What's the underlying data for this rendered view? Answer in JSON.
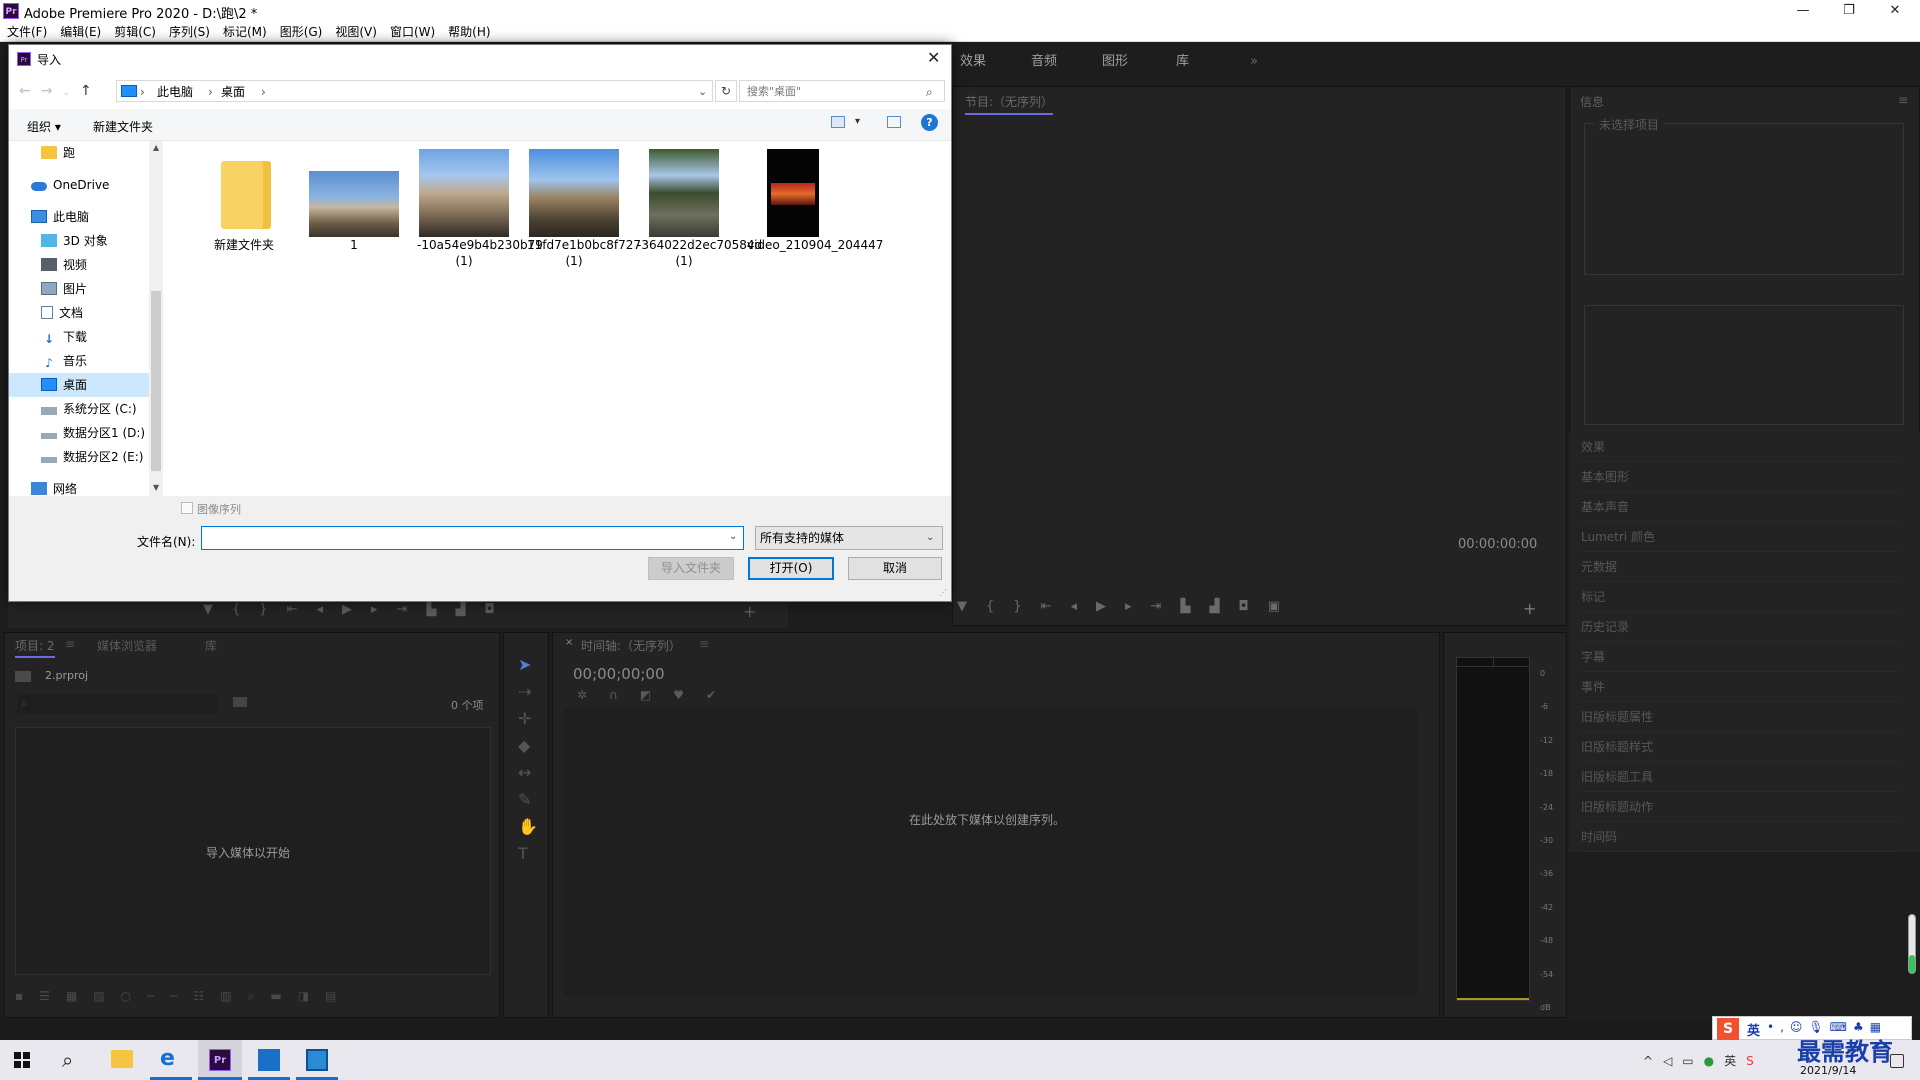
{
  "app": {
    "title": "Adobe Premiere Pro 2020 - D:\\跑\\2 *",
    "logo_text": "Pr",
    "window_buttons": [
      "—",
      "❐",
      "✕"
    ]
  },
  "menu": [
    "文件(F)",
    "编辑(E)",
    "剪辑(C)",
    "序列(S)",
    "标记(M)",
    "图形(G)",
    "视图(V)",
    "窗口(W)",
    "帮助(H)"
  ],
  "workspace_tabs": [
    "效果",
    "音频",
    "图形",
    "库",
    "»"
  ],
  "program_monitor": {
    "tab": "节目:（无序列）",
    "timecode": "00:00:00:00"
  },
  "info_panel": {
    "title": "信息",
    "no_selection": "未选择项目"
  },
  "side_panels": [
    "效果",
    "基本图形",
    "基本声音",
    "Lumetri 颜色",
    "元数据",
    "标记",
    "历史记录",
    "字幕",
    "事件",
    "旧版标题属性",
    "旧版标题样式",
    "旧版标题工具",
    "旧版标题动作",
    "时间码"
  ],
  "project_panel": {
    "tabs": [
      "项目: 2",
      "媒体浏览器",
      "库"
    ],
    "file": "2.prproj",
    "item_count": "0 个项",
    "empty_text": "导入媒体以开始"
  },
  "timeline": {
    "tab": "时间轴:（无序列）",
    "timecode": "00;00;00;00",
    "empty_text": "在此处放下媒体以创建序列。"
  },
  "audio_meter": {
    "ticks": [
      "0",
      "-6",
      "-12",
      "-18",
      "-24",
      "-30",
      "-36",
      "-42",
      "-48",
      "-54",
      "dB"
    ]
  },
  "dialog": {
    "title": "导入",
    "breadcrumb": [
      "此电脑",
      "桌面"
    ],
    "search_placeholder": "搜索\"桌面\"",
    "organize": "组织 ▾",
    "new_folder": "新建文件夹",
    "help": "?",
    "tree": [
      {
        "label": "跑",
        "icon": "folder"
      },
      {
        "label": "OneDrive",
        "icon": "cloud"
      },
      {
        "label": "此电脑",
        "icon": "computer"
      },
      {
        "label": "3D 对象",
        "icon": "cube"
      },
      {
        "label": "视频",
        "icon": "film"
      },
      {
        "label": "图片",
        "icon": "picture"
      },
      {
        "label": "文档",
        "icon": "document"
      },
      {
        "label": "下载",
        "icon": "download"
      },
      {
        "label": "音乐",
        "icon": "music"
      },
      {
        "label": "桌面",
        "icon": "desktop"
      },
      {
        "label": "系统分区 (C:)",
        "icon": "drive"
      },
      {
        "label": "数据分区1 (D:)",
        "icon": "drive"
      },
      {
        "label": "数据分区2 (E:)",
        "icon": "drive"
      },
      {
        "label": "网络",
        "icon": "network"
      }
    ],
    "files": [
      {
        "name": "新建文件夹",
        "type": "folder"
      },
      {
        "name": "1",
        "type": "image"
      },
      {
        "name": "-10a54e9b4b230b79 (1)",
        "type": "image"
      },
      {
        "name": "11fd7e1b0bc8f727 (1)",
        "type": "image"
      },
      {
        "name": "-364022d2ec70584d (1)",
        "type": "image"
      },
      {
        "name": "video_210904_204447",
        "type": "video"
      }
    ],
    "image_sequence_label": "图像序列",
    "filename_label": "文件名(N):",
    "filename_value": "",
    "filter": "所有支持的媒体",
    "import_folder_btn": "导入文件夹",
    "open_btn": "打开(O)",
    "cancel_btn": "取消"
  },
  "taskbar": {
    "ime": "英",
    "watermark": "最需教育",
    "date": "2021/9/14"
  },
  "colors": {
    "accent": "#0078d7",
    "pr_purple": "#9999ff",
    "dark_bg": "#1d1d1d",
    "panel_bg": "#232323"
  }
}
